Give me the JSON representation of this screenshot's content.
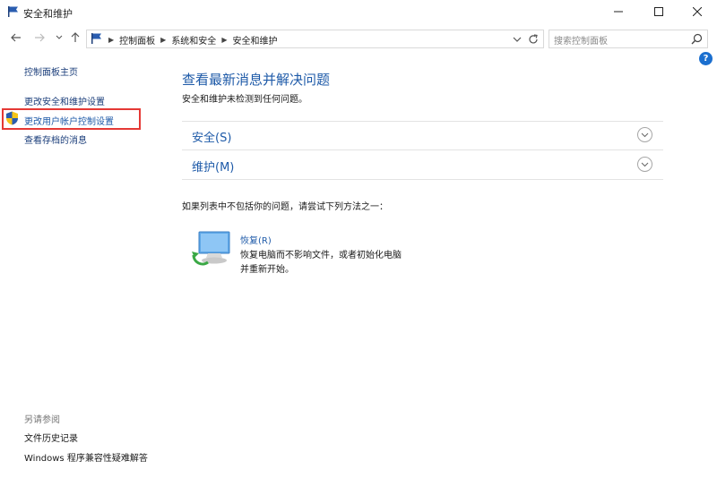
{
  "window": {
    "title": "安全和维护"
  },
  "address_bar": {
    "breadcrumbs": [
      "控制面板",
      "系统和安全",
      "安全和维护"
    ]
  },
  "search": {
    "placeholder": "搜索控制面板"
  },
  "help": {
    "label": "?"
  },
  "left_pane": {
    "home_link": "控制面板主页",
    "links": [
      "更改安全和维护设置",
      "更改用户帐户控制设置",
      "查看存档的消息"
    ],
    "see_also_header": "另请参阅",
    "see_also_links": [
      "文件历史记录",
      "Windows 程序兼容性疑难解答"
    ]
  },
  "main": {
    "title": "查看最新消息并解决问题",
    "subtitle": "安全和维护未检测到任何问题。",
    "sections": [
      "安全(S)",
      "维护(M)"
    ],
    "hint": "如果列表中不包括你的问题，请尝试下列方法之一：",
    "recovery": {
      "link": "恢复(R)",
      "description": "恢复电脑而不影响文件，或者初始化电脑并重新开始。"
    }
  },
  "colors": {
    "link_blue": "#1e5aa8",
    "highlight_red": "#e53935",
    "help_blue": "#1b6fcf"
  },
  "icons": [
    "flag-icon",
    "minimize-icon",
    "maximize-icon",
    "close-icon",
    "back-arrow-icon",
    "forward-arrow-icon",
    "recent-dropdown-icon",
    "up-arrow-icon",
    "chevron-down-icon",
    "refresh-icon",
    "search-icon",
    "help-icon",
    "uac-shield-icon",
    "expand-chevron-icon",
    "recovery-icon"
  ]
}
